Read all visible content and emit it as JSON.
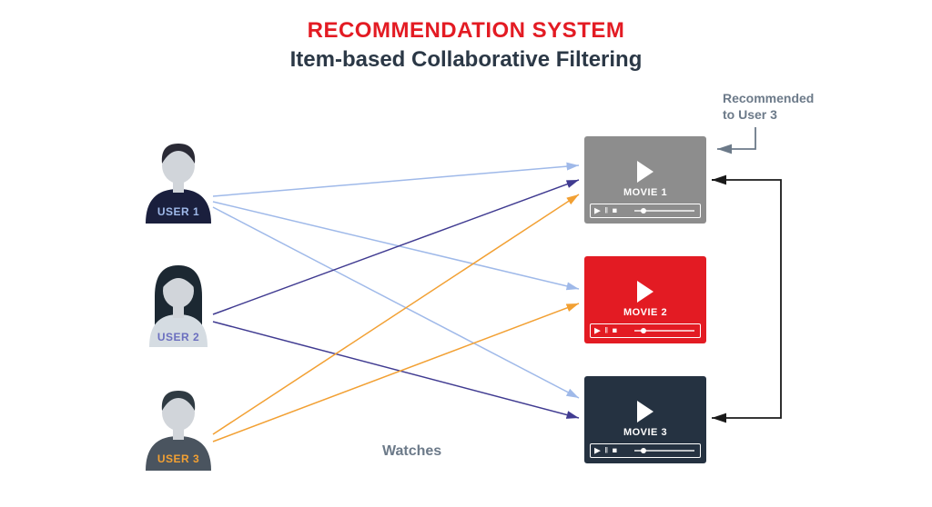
{
  "header": {
    "title": "RECOMMENDATION SYSTEM",
    "subtitle": "Item-based Collaborative Filtering"
  },
  "users": [
    {
      "label": "USER 1",
      "label_color": "#9fb9e9",
      "shirt_color": "#1a1f3d",
      "hair_color": "#2a2a35",
      "hair_type": "short"
    },
    {
      "label": "USER 2",
      "label_color": "#6b6fbf",
      "shirt_color": "#d5dce2",
      "hair_color": "#1c2832",
      "hair_type": "long"
    },
    {
      "label": "USER 3",
      "label_color": "#f2a033",
      "shirt_color": "#4a545f",
      "hair_color": "#2f3a42",
      "hair_type": "short"
    }
  ],
  "movies": [
    {
      "label": "MOVIE 1",
      "color": "#8d8d8d"
    },
    {
      "label": "MOVIE 2",
      "color": "#e31b23"
    },
    {
      "label": "MOVIE 3",
      "color": "#253241"
    }
  ],
  "labels": {
    "watches": "Watches",
    "recommended_line1": "Recommended",
    "recommended_line2": "to User 3"
  },
  "arrow_colors": {
    "user1": "#9fb9e9",
    "user2": "#403b91",
    "user3": "#f2a033",
    "note": "#6c7a89",
    "similarity": "#1a1a1a"
  },
  "edges": [
    {
      "from": "USER 1",
      "to": "MOVIE 1",
      "color": "user1"
    },
    {
      "from": "USER 1",
      "to": "MOVIE 2",
      "color": "user1"
    },
    {
      "from": "USER 1",
      "to": "MOVIE 3",
      "color": "user1"
    },
    {
      "from": "USER 2",
      "to": "MOVIE 1",
      "color": "user2"
    },
    {
      "from": "USER 2",
      "to": "MOVIE 3",
      "color": "user2"
    },
    {
      "from": "USER 3",
      "to": "MOVIE 1",
      "color": "user3",
      "note": "recommended"
    },
    {
      "from": "USER 3",
      "to": "MOVIE 2",
      "color": "user3"
    }
  ],
  "similarity_link": {
    "between": [
      "MOVIE 1",
      "MOVIE 3"
    ]
  }
}
